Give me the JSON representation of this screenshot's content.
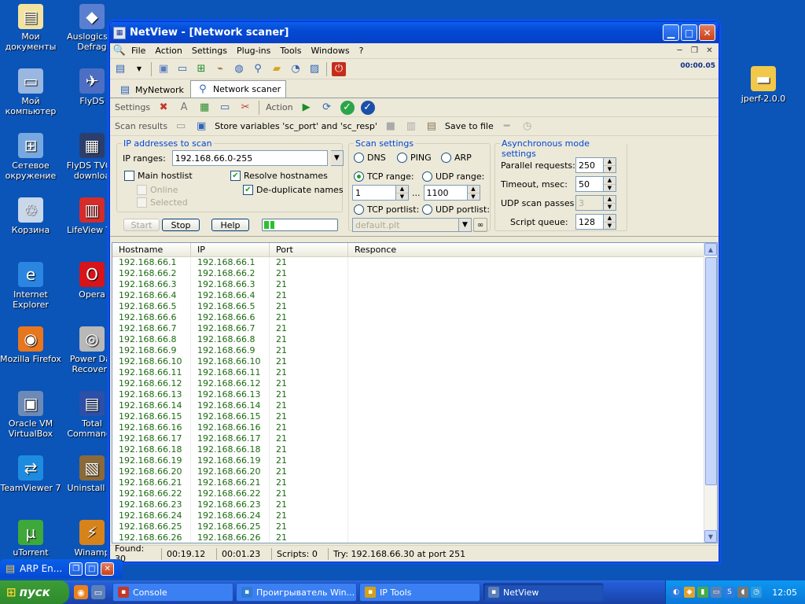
{
  "desktop": {
    "icons_left": [
      {
        "label": "Мои документы",
        "icon": "folder-documents-icon",
        "color": "#f3e3a0",
        "glyph": "▤"
      },
      {
        "label": "Мой компьютер",
        "icon": "my-computer-icon",
        "color": "#9ab7e0",
        "glyph": "▭"
      },
      {
        "label": "Сетевое окружение",
        "icon": "network-places-icon",
        "color": "#77a9e0",
        "glyph": "⊞"
      },
      {
        "label": "Корзина",
        "icon": "recycle-bin-icon",
        "color": "#c9d7ea",
        "glyph": "♲"
      },
      {
        "label": "Internet Explorer",
        "icon": "internet-explorer-icon",
        "color": "#2a86e0",
        "glyph": "e"
      },
      {
        "label": "Mozilla Firefox",
        "icon": "firefox-icon",
        "color": "#e8761d",
        "glyph": "◉"
      },
      {
        "label": "Oracle VM VirtualBox",
        "icon": "virtualbox-icon",
        "color": "#6c8ab8",
        "glyph": "▣"
      },
      {
        "label": "TeamViewer 7",
        "icon": "teamviewer-icon",
        "color": "#1d8ce0",
        "glyph": "⇄"
      },
      {
        "label": "uTorrent",
        "icon": "utorrent-icon",
        "color": "#3ea93a",
        "glyph": "µ"
      }
    ],
    "icons_right_col": [
      {
        "label": "Auslogics D Defrag",
        "icon": "defrag-icon",
        "color": "#5b7fd0",
        "glyph": "◆"
      },
      {
        "label": "FlyDS",
        "icon": "flyds-icon",
        "color": "#4c6fc4",
        "glyph": "✈"
      },
      {
        "label": "FlyDS TVGu downloa",
        "icon": "flyds-tvguide-icon",
        "color": "#2b3e6e",
        "glyph": "▦"
      },
      {
        "label": "LifeView TV",
        "icon": "lifeview-icon",
        "color": "#d42b2b",
        "glyph": "▥"
      },
      {
        "label": "Opera",
        "icon": "opera-icon",
        "color": "#d6141a",
        "glyph": "O"
      },
      {
        "label": "Power Dat Recovery",
        "icon": "power-data-recovery-icon",
        "color": "#b8b8b8",
        "glyph": "◎"
      },
      {
        "label": "Total Commande",
        "icon": "total-commander-icon",
        "color": "#2c4fa8",
        "glyph": "▤"
      },
      {
        "label": "Uninstall To",
        "icon": "uninstall-tool-icon",
        "color": "#8a6a3a",
        "glyph": "▧"
      },
      {
        "label": "Winamp",
        "icon": "winamp-icon",
        "color": "#d6831c",
        "glyph": "⚡"
      }
    ],
    "icon_far_right": {
      "label": "jperf-2.0.0",
      "icon": "folder-icon"
    }
  },
  "window": {
    "title": "NetView - [Network scaner]",
    "menu": [
      "File",
      "Action",
      "Settings",
      "Plug-ins",
      "Tools",
      "Windows",
      "?"
    ],
    "timer": "00:00.05",
    "tabs": [
      "MyNetwork",
      "Network scaner"
    ],
    "settings_bar": {
      "settings_label": "Settings",
      "action_label": "Action"
    },
    "results_bar": {
      "scan_results": "Scan results",
      "store_vars": "Store variables 'sc_port' and 'sc_resp'",
      "save_to_file": "Save to file"
    },
    "ip_group": {
      "title": "IP addresses to scan",
      "ranges_label": "IP ranges:",
      "ranges_value": "192.168.66.0-255",
      "main_hostlist": "Main hostlist",
      "online": "Online",
      "selected": "Selected",
      "resolve_hostnames": "Resolve hostnames",
      "dedup_names": "De-duplicate names"
    },
    "buttons": {
      "start": "Start",
      "stop": "Stop",
      "help": "Help"
    },
    "progress_percent": 14,
    "scan_settings": {
      "title": "Scan settings",
      "dns": "DNS",
      "ping": "PING",
      "arp": "ARP",
      "tcp_range": "TCP range:",
      "udp_range": "UDP range:",
      "range_from": "1",
      "range_sep": "...",
      "range_to": "1100",
      "tcp_portlist": "TCP portlist:",
      "udp_portlist": "UDP portlist:",
      "portlist_value": "default.plt"
    },
    "async_settings": {
      "title": "Asynchronous mode settings",
      "parallel_label": "Parallel requests:",
      "parallel_value": "250",
      "timeout_label": "Timeout, msec:",
      "timeout_value": "50",
      "udp_passes_label": "UDP scan passes",
      "udp_passes_value": "3",
      "script_queue_label": "Script queue:",
      "script_queue_value": "128"
    },
    "table": {
      "columns": [
        "Hostname",
        "IP",
        "Port",
        "Responce"
      ],
      "rows": [
        [
          "192.168.66.1",
          "192.168.66.1",
          "21"
        ],
        [
          "192.168.66.2",
          "192.168.66.2",
          "21"
        ],
        [
          "192.168.66.3",
          "192.168.66.3",
          "21"
        ],
        [
          "192.168.66.4",
          "192.168.66.4",
          "21"
        ],
        [
          "192.168.66.5",
          "192.168.66.5",
          "21"
        ],
        [
          "192.168.66.6",
          "192.168.66.6",
          "21"
        ],
        [
          "192.168.66.7",
          "192.168.66.7",
          "21"
        ],
        [
          "192.168.66.8",
          "192.168.66.8",
          "21"
        ],
        [
          "192.168.66.9",
          "192.168.66.9",
          "21"
        ],
        [
          "192.168.66.10",
          "192.168.66.10",
          "21"
        ],
        [
          "192.168.66.11",
          "192.168.66.11",
          "21"
        ],
        [
          "192.168.66.12",
          "192.168.66.12",
          "21"
        ],
        [
          "192.168.66.13",
          "192.168.66.13",
          "21"
        ],
        [
          "192.168.66.14",
          "192.168.66.14",
          "21"
        ],
        [
          "192.168.66.15",
          "192.168.66.15",
          "21"
        ],
        [
          "192.168.66.16",
          "192.168.66.16",
          "21"
        ],
        [
          "192.168.66.17",
          "192.168.66.17",
          "21"
        ],
        [
          "192.168.66.18",
          "192.168.66.18",
          "21"
        ],
        [
          "192.168.66.19",
          "192.168.66.19",
          "21"
        ],
        [
          "192.168.66.20",
          "192.168.66.20",
          "21"
        ],
        [
          "192.168.66.21",
          "192.168.66.21",
          "21"
        ],
        [
          "192.168.66.22",
          "192.168.66.22",
          "21"
        ],
        [
          "192.168.66.23",
          "192.168.66.23",
          "21"
        ],
        [
          "192.168.66.24",
          "192.168.66.24",
          "21"
        ],
        [
          "192.168.66.25",
          "192.168.66.25",
          "21"
        ],
        [
          "192.168.66.26",
          "192.168.66.26",
          "21"
        ]
      ]
    },
    "status": {
      "found": "Found: 30",
      "elapsed": "00:19.12",
      "remaining": "00:01.23",
      "scripts": "Scripts: 0",
      "try": "Try: 192.168.66.30 at port 251"
    }
  },
  "minimized_window": {
    "title": "ARP En..."
  },
  "taskbar": {
    "start": "пуск",
    "tasks": [
      {
        "label": "Console",
        "icon": "console-icon",
        "color": "#c0392b"
      },
      {
        "label": "Проигрыватель Win...",
        "icon": "media-player-icon",
        "color": "#2e7bd6"
      },
      {
        "label": "IP Tools",
        "icon": "ip-tools-icon",
        "color": "#d4a017"
      },
      {
        "label": "NetView",
        "icon": "netview-icon",
        "color": "#5d7fb8"
      }
    ],
    "clock": "12:05"
  }
}
